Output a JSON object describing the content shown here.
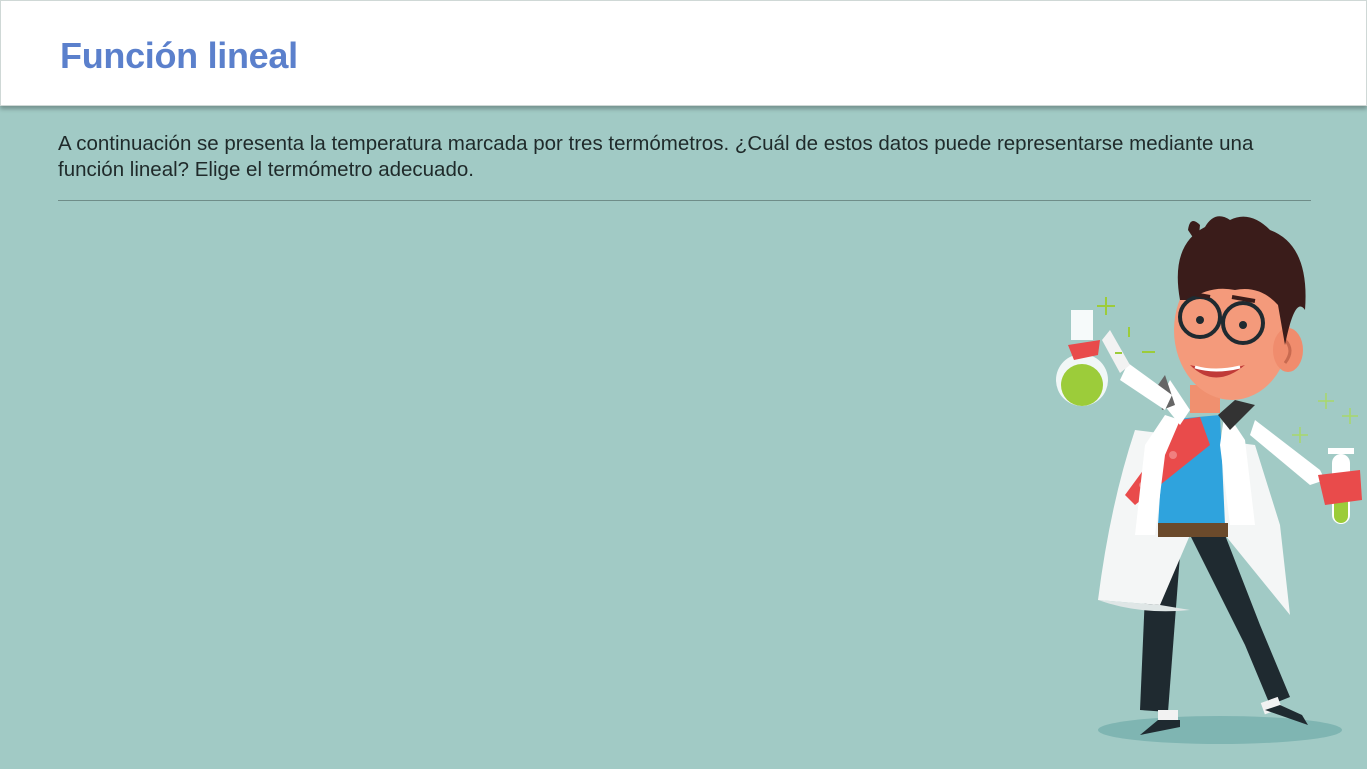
{
  "header": {
    "title": "Función lineal"
  },
  "main": {
    "instruction": "A continuación se presenta la temperatura marcada por tres termómetros. ¿Cuál de estos datos puede representarse mediante una función lineal? Elige el termómetro adecuado."
  },
  "illustration": {
    "icon": "scientist-icon"
  },
  "colors": {
    "background": "#a1cac5",
    "title": "#5b80cc",
    "header_bg": "#ffffff"
  }
}
